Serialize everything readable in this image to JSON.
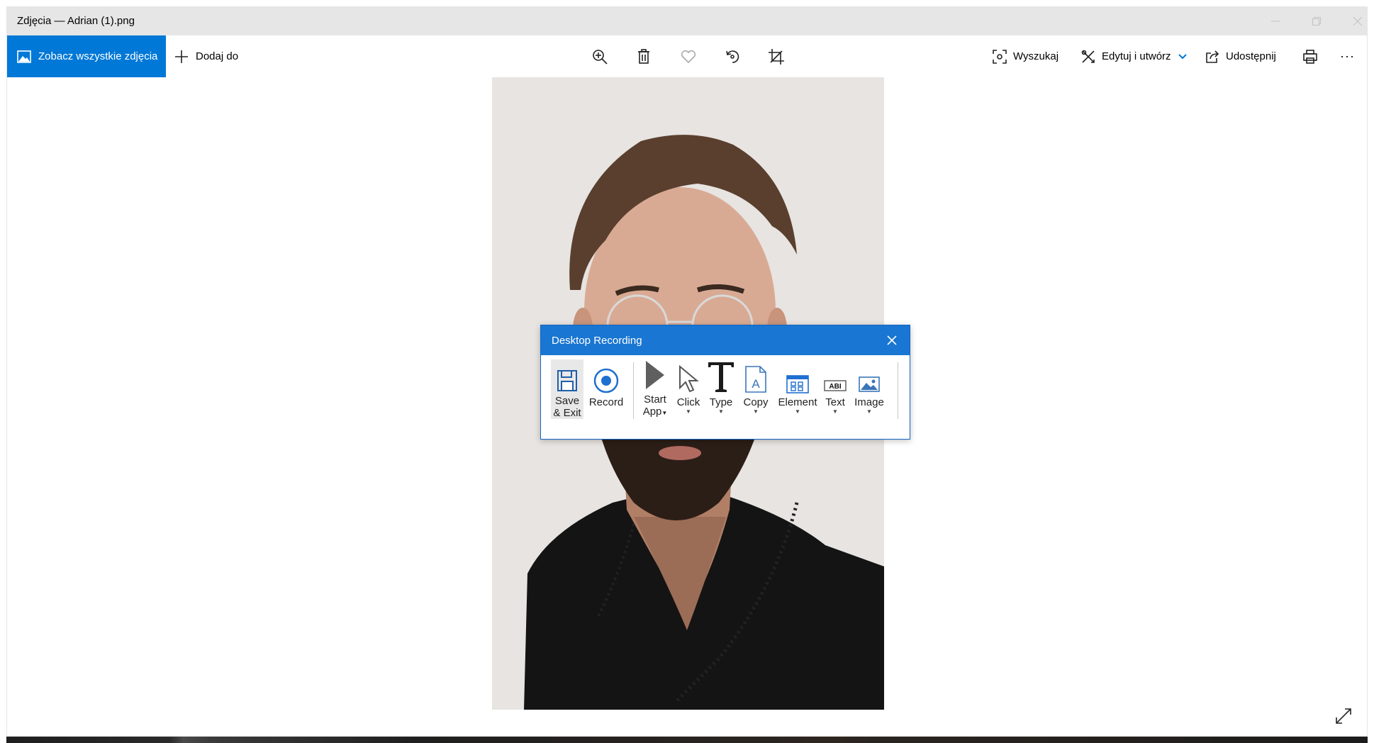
{
  "window": {
    "title": "Zdjęcia — Adrian (1).png"
  },
  "toolbar": {
    "see_all_label": "Zobacz wszystkie zdjęcia",
    "add_to_label": "Dodaj do",
    "search_label": "Wyszukaj",
    "edit_label": "Edytuj i utwórz",
    "share_label": "Udostępnij",
    "more_label": "···",
    "icons": [
      "zoom-in-icon",
      "delete-icon",
      "favorite-icon",
      "rotate-icon",
      "crop-icon",
      "print-icon"
    ]
  },
  "photo": {
    "subject": "Adrian (1).png"
  },
  "dialog": {
    "title": "Desktop Recording",
    "buttons": [
      {
        "label_line1": "Save",
        "label_line2": "& Exit",
        "icon": "save-icon"
      },
      {
        "label_line1": "Record",
        "label_line2": "",
        "icon": "record-icon"
      },
      {
        "label_line1": "Start",
        "label_line2": "App",
        "icon": "play-icon",
        "dropdown": true
      },
      {
        "label_line1": "Click",
        "label_line2": "",
        "icon": "cursor-icon",
        "dropdown": true
      },
      {
        "label_line1": "Type",
        "label_line2": "",
        "icon": "type-icon",
        "dropdown": true
      },
      {
        "label_line1": "Copy",
        "label_line2": "",
        "icon": "copy-icon",
        "dropdown": true
      },
      {
        "label_line1": "Element",
        "label_line2": "",
        "icon": "element-icon",
        "dropdown": true
      },
      {
        "label_line1": "Text",
        "label_line2": "",
        "icon": "text-icon",
        "dropdown": true
      },
      {
        "label_line1": "Image",
        "label_line2": "",
        "icon": "image-icon",
        "dropdown": true
      }
    ],
    "text_icon_glyph": "ABI"
  },
  "colors": {
    "accent": "#0078d7",
    "dialog_header": "#1976d2",
    "titlebar": "#e6e6e6",
    "photo_bg": "#e7e4e1"
  }
}
